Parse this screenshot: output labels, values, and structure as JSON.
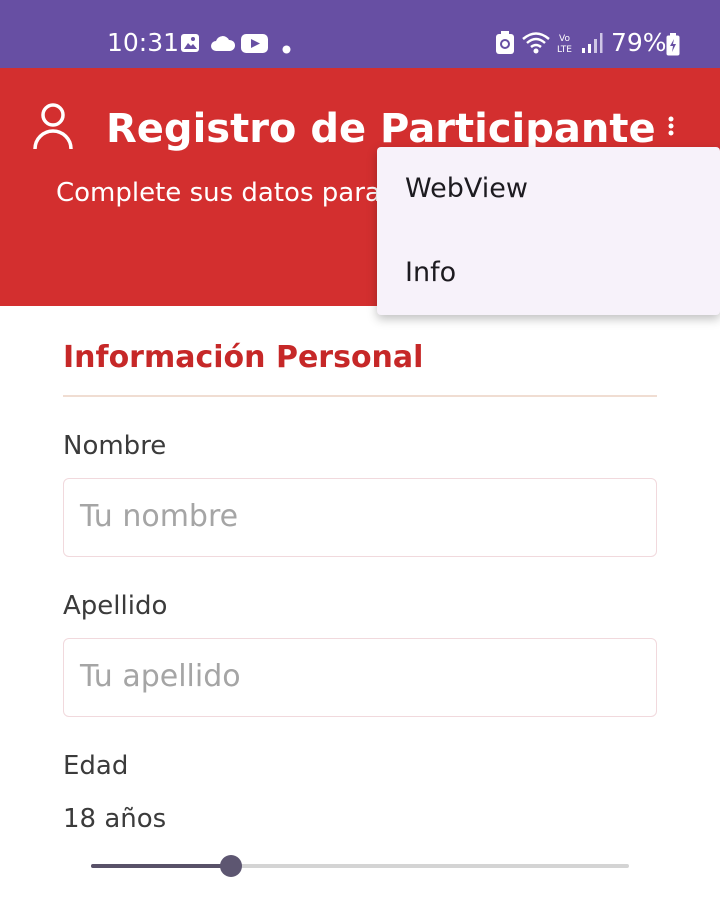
{
  "status_bar": {
    "time": "10:31",
    "battery": "79%",
    "left_icons": [
      "gallery-icon",
      "cloud-icon",
      "youtube-icon",
      "dot-icon"
    ],
    "right_icons": [
      "recycle-icon",
      "wifi-icon",
      "volte-icon",
      "signal-icon",
      "battery-icon"
    ],
    "color": "#674fa3"
  },
  "header": {
    "title": "Registro de Participante",
    "subtitle": "Complete sus datos para registrar su asistencia",
    "icon": "person-icon",
    "color": "#d32f2f"
  },
  "overflow_menu": {
    "icon": "more-vert-icon",
    "items": [
      {
        "label": "WebView"
      },
      {
        "label": "Info"
      }
    ]
  },
  "form": {
    "section_title": "Información Personal",
    "nombre": {
      "label": "Nombre",
      "placeholder": "Tu nombre"
    },
    "apellido": {
      "label": "Apellido",
      "placeholder": "Tu apellido"
    },
    "edad": {
      "label": "Edad",
      "value_text": "18 años",
      "slider_fraction": 0.26
    }
  }
}
